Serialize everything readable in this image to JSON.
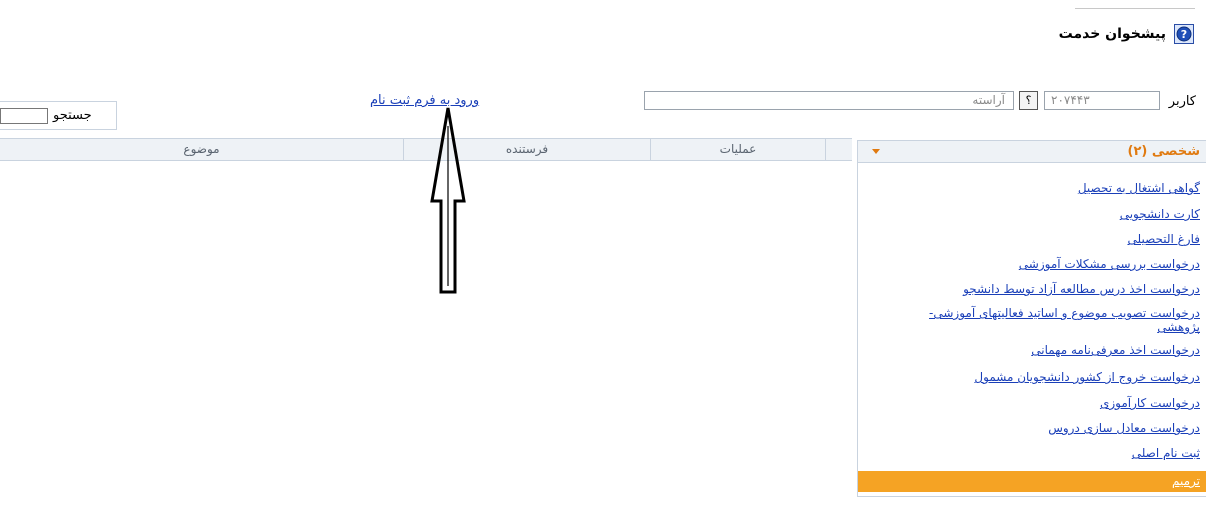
{
  "header": {
    "title": "پیشخوان خدمت",
    "help_icon": "help-circle-icon"
  },
  "user": {
    "label": "کاربر",
    "id_value": "۲۰۷۴۴۳",
    "lookup_button": "؟",
    "name_value": "آراسته"
  },
  "enroll_link": "ورود به فرم ثبت نام",
  "search": {
    "label": "جستجو",
    "value": ""
  },
  "table": {
    "columns": [
      "موضوع",
      "فرستنده",
      "عملیات"
    ]
  },
  "panel": {
    "title": "شخصی (۲)",
    "items": [
      "گواهی اشتغال به تحصیل",
      "کارت دانشجویی",
      "فارغ التحصیلی",
      "درخواست بررسی مشکلات آموزشی",
      "درخواست اخذ درس مطالعه آزاد توسط دانشجو",
      "درخواست تصویب موضوع و اساتید فعالیتهای آموزشی-پژوهشی",
      "درخواست اخذ معرفی‌نامه مهمانی",
      "درخواست خروج از کشور دانشجویان مشمول",
      "درخواست کارآموزی",
      "درخواست معادل سازی دروس",
      "ثبت نام اصلی"
    ],
    "selected": "ترمیم"
  },
  "colors": {
    "link": "#1a3fb8",
    "panel_title": "#e07a10",
    "selected_bg": "#f5a324",
    "header_bg": "#eef2f6"
  }
}
